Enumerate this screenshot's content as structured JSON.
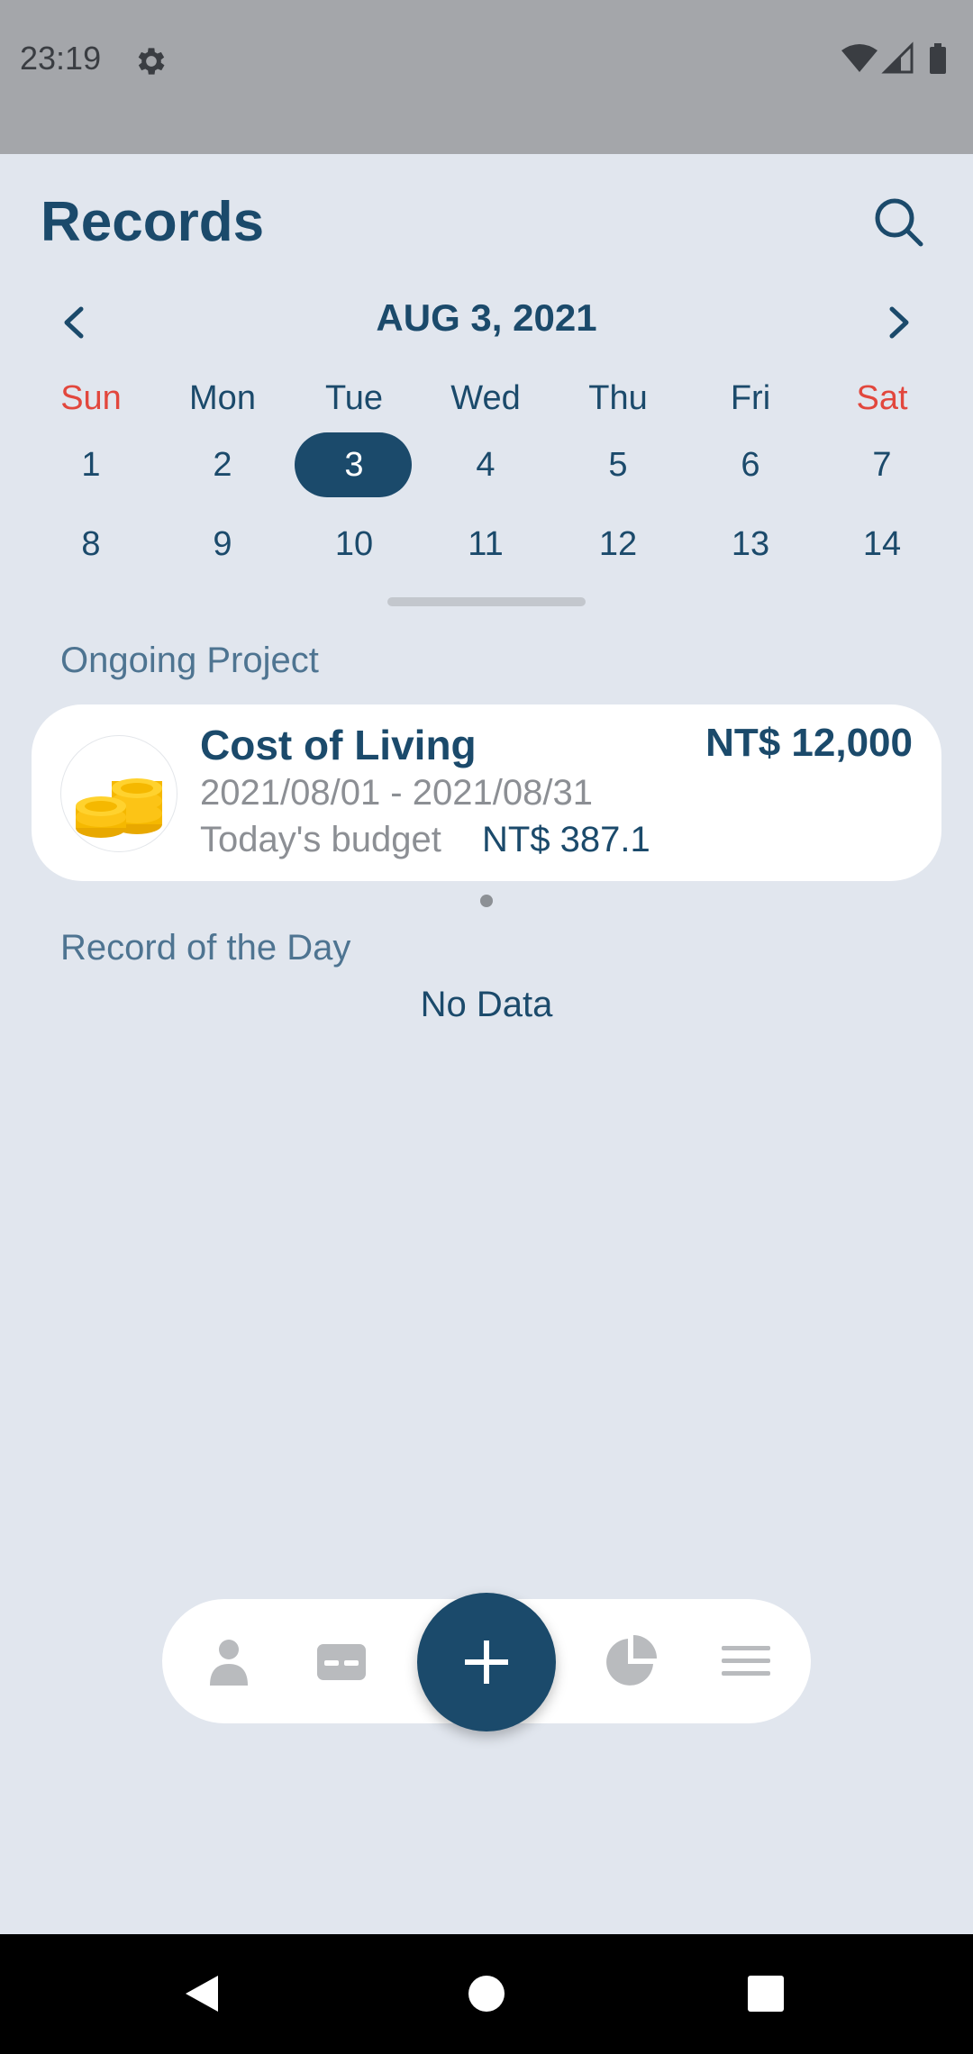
{
  "status_bar": {
    "time": "23:19"
  },
  "header": {
    "title": "Records"
  },
  "calendar": {
    "month_label": "AUG 3, 2021",
    "weekdays": [
      "Sun",
      "Mon",
      "Tue",
      "Wed",
      "Thu",
      "Fri",
      "Sat"
    ],
    "weeks": [
      [
        "1",
        "2",
        "3",
        "4",
        "5",
        "6",
        "7"
      ],
      [
        "8",
        "9",
        "10",
        "11",
        "12",
        "13",
        "14"
      ]
    ],
    "selected_day": "3"
  },
  "ongoing": {
    "section_label": "Ongoing Project",
    "project": {
      "name": "Cost of Living",
      "amount": "NT$ 12,000",
      "date_range": "2021/08/01 - 2021/08/31",
      "budget_label": "Today's budget",
      "budget_value": "NT$ 387.1"
    }
  },
  "day_records": {
    "section_label": "Record of the Day",
    "empty_text": "No Data"
  },
  "colors": {
    "primary": "#1b4a6b",
    "weekend": "#e2473d",
    "background": "#e1e6ee"
  },
  "icons": {
    "status": [
      "gear-icon",
      "wifi-icon",
      "signal-icon",
      "battery-icon"
    ],
    "bottom_nav": [
      "person-icon",
      "card-icon",
      "plus-icon",
      "pie-chart-icon",
      "list-icon"
    ]
  }
}
